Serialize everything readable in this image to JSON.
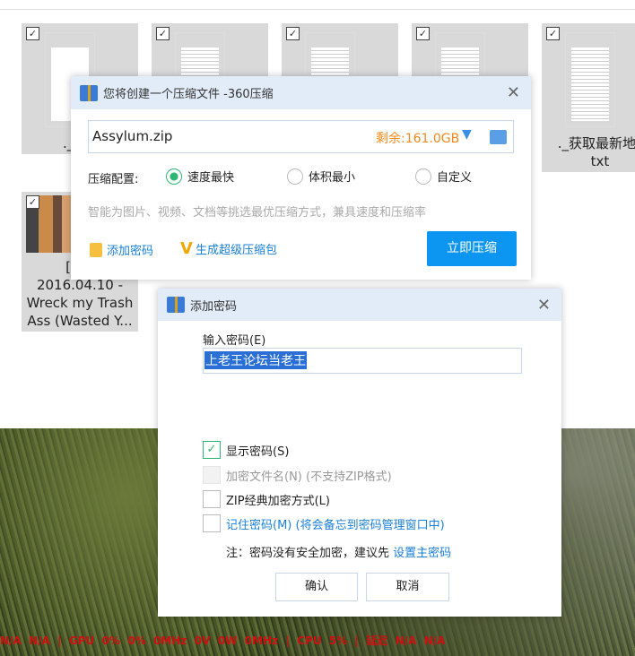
{
  "files": [
    {
      "name": "._.DS"
    },
    {
      "name": ""
    },
    {
      "name": ""
    },
    {
      "name": ""
    },
    {
      "name": "._获取最新地址",
      "name2": "txt"
    },
    {
      "name": "[Ass",
      "name2": "2016.04.10 -",
      "name3": "Wreck my Trash",
      "name4": "Ass (Wasted Y..."
    }
  ],
  "compress_dialog": {
    "title": "您将创建一个压缩文件 -360压缩",
    "filename": "Assylum.zip",
    "free_space": "剩余:161.0GB",
    "config_label": "压缩配置:",
    "options": [
      "速度最快",
      "体积最小",
      "自定义"
    ],
    "selected_option": "速度最快",
    "hint": "智能为图片、视频、文档等挑选最优压缩方式，兼具速度和压缩率",
    "add_password": "添加密码",
    "super_pack": "生成超级压缩包",
    "compress_now": "立即压缩"
  },
  "password_dialog": {
    "title": "添加密码",
    "input_label": "输入密码(E)",
    "password": "上老王论坛当老王",
    "show_password": "显示密码(S)",
    "encrypt_names": "加密文件名(N) (不支持ZIP格式)",
    "zip_classic": "ZIP经典加密方式(L)",
    "remember": "记住密码(M) (将会备忘到密码管理窗口中)",
    "note": "注：密码没有安全加密，建议先 ",
    "note_link": "设置主密码",
    "ok": "确认",
    "cancel": "取消"
  },
  "osd": "N/A  N/A  |  GPU  0%  0%  0MHz  0V  0W  0MHz  |  CPU  5%  |  延迟  N/A  N/A"
}
